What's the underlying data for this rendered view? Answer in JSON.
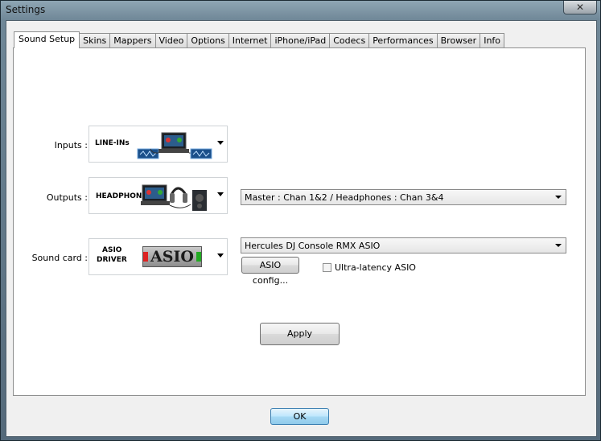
{
  "window": {
    "title": "Settings",
    "close_glyph": "✕"
  },
  "tabs": [
    {
      "label": "Sound Setup",
      "active": true
    },
    {
      "label": "Skins"
    },
    {
      "label": "Mappers"
    },
    {
      "label": "Video"
    },
    {
      "label": "Options"
    },
    {
      "label": "Internet"
    },
    {
      "label": "iPhone/iPad"
    },
    {
      "label": "Codecs"
    },
    {
      "label": "Performances"
    },
    {
      "label": "Browser"
    },
    {
      "label": "Info"
    }
  ],
  "sound_setup": {
    "inputs": {
      "label": "Inputs :",
      "icon_caption": "LINE-INs"
    },
    "outputs": {
      "label": "Outputs :",
      "icon_caption": "HEADPHONES",
      "routing_value": "Master : Chan 1&2 / Headphones : Chan 3&4"
    },
    "sound_card": {
      "label": "Sound card :",
      "icon_caption_line1": "ASIO",
      "icon_caption_line2": "DRIVER",
      "logo_text": "ASIO",
      "device_value": "Hercules DJ Console RMX ASIO",
      "config_button": "ASIO config...",
      "ultra_latency_label": "Ultra-latency ASIO",
      "ultra_latency_checked": false
    },
    "apply_button": "Apply"
  },
  "footer": {
    "ok_button": "OK"
  }
}
